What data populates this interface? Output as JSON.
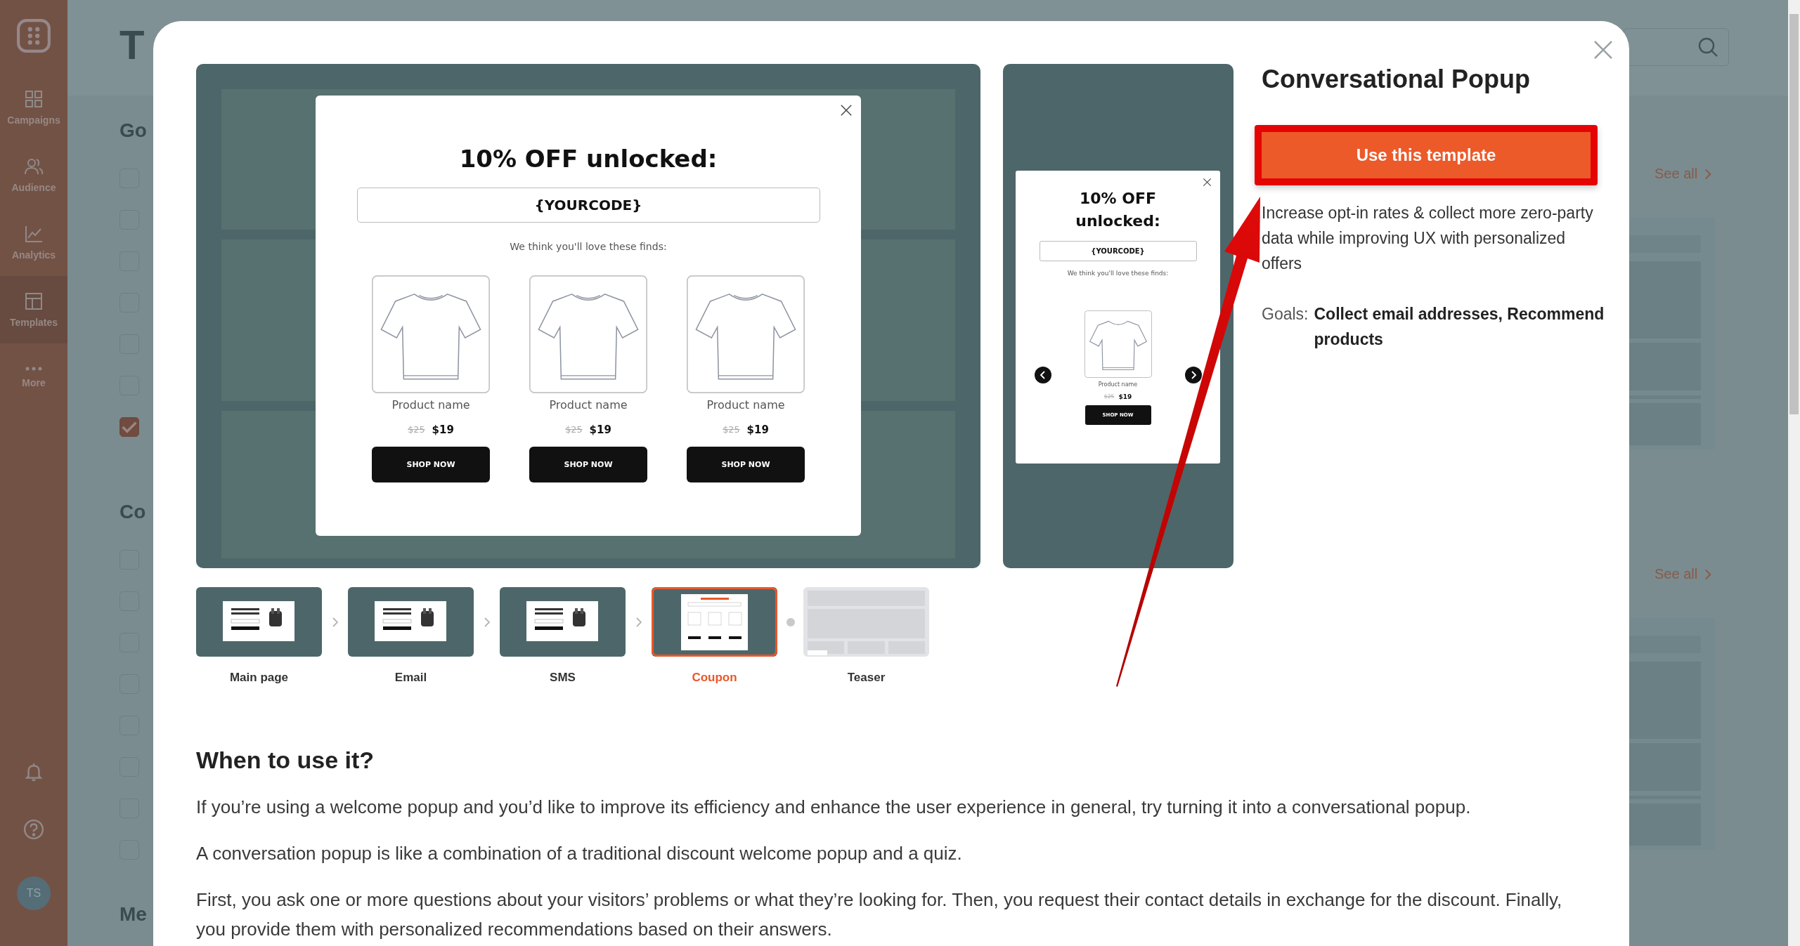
{
  "sidebar": {
    "items": [
      {
        "label": "Campaigns",
        "selected": false
      },
      {
        "label": "Audience",
        "selected": false
      },
      {
        "label": "Analytics",
        "selected": false
      },
      {
        "label": "Templates",
        "selected": true
      },
      {
        "label": "More",
        "selected": false
      }
    ],
    "avatar": "TS"
  },
  "background": {
    "title": "T",
    "sections": [
      {
        "heading": "Go",
        "checkboxes": [
          {
            "checked": false
          },
          {
            "checked": false
          },
          {
            "checked": false
          },
          {
            "checked": false
          },
          {
            "checked": false
          },
          {
            "checked": false
          },
          {
            "checked": true
          }
        ]
      },
      {
        "heading": "Co",
        "checkboxes": [
          {
            "checked": false
          },
          {
            "checked": false
          },
          {
            "checked": false
          },
          {
            "checked": false
          },
          {
            "checked": false
          },
          {
            "checked": false
          },
          {
            "checked": false
          },
          {
            "checked": false
          }
        ]
      },
      {
        "heading": "Me"
      }
    ],
    "see_all": [
      "See all",
      "See all"
    ]
  },
  "modal": {
    "desktop_popup": {
      "title": "10% OFF unlocked:",
      "code": "{YOURCODE}",
      "subtitle": "We think you'll love these finds:",
      "products": [
        {
          "name": "Product name",
          "old_price": "$25",
          "price": "$19",
          "button": "SHOP NOW"
        },
        {
          "name": "Product name",
          "old_price": "$25",
          "price": "$19",
          "button": "SHOP NOW"
        },
        {
          "name": "Product name",
          "old_price": "$25",
          "price": "$19",
          "button": "SHOP NOW"
        }
      ]
    },
    "mobile_popup": {
      "title": "10% OFF unlocked:",
      "code": "{YOURCODE}",
      "subtitle": "We think you'll love these finds:",
      "products": [
        {
          "name": "Product name",
          "old_price": "$25",
          "price": "$19",
          "button": "SHOP NOW"
        }
      ]
    },
    "title": "Conversational Popup",
    "button": "Use this template",
    "description": "Increase opt-in rates & collect more zero-party data while improving UX with personalized offers",
    "goals_label": "Goals:",
    "goals": "Collect email addresses, Recommend products",
    "steps": [
      {
        "label": "Main page",
        "selected": false,
        "kind": "popup"
      },
      {
        "label": "Email",
        "selected": false,
        "kind": "popup"
      },
      {
        "label": "SMS",
        "selected": false,
        "kind": "popup"
      },
      {
        "label": "Coupon",
        "selected": true,
        "kind": "coupon"
      },
      {
        "label": "Teaser",
        "selected": false,
        "kind": "teaser"
      }
    ],
    "section": {
      "heading": "When to use it?",
      "paragraphs": [
        "If you’re using a welcome popup and you’d like to improve its efficiency and enhance the user experience in general, try turning it into a conversational popup.",
        "A conversation popup is like a combination of a traditional discount welcome popup and a quiz.",
        "First, you ask one or more questions about your visitors’ problems or what they’re looking for. Then, you request their contact details in exchange for the discount. Finally, you provide them with personalized recommendations based on their answers."
      ]
    }
  }
}
